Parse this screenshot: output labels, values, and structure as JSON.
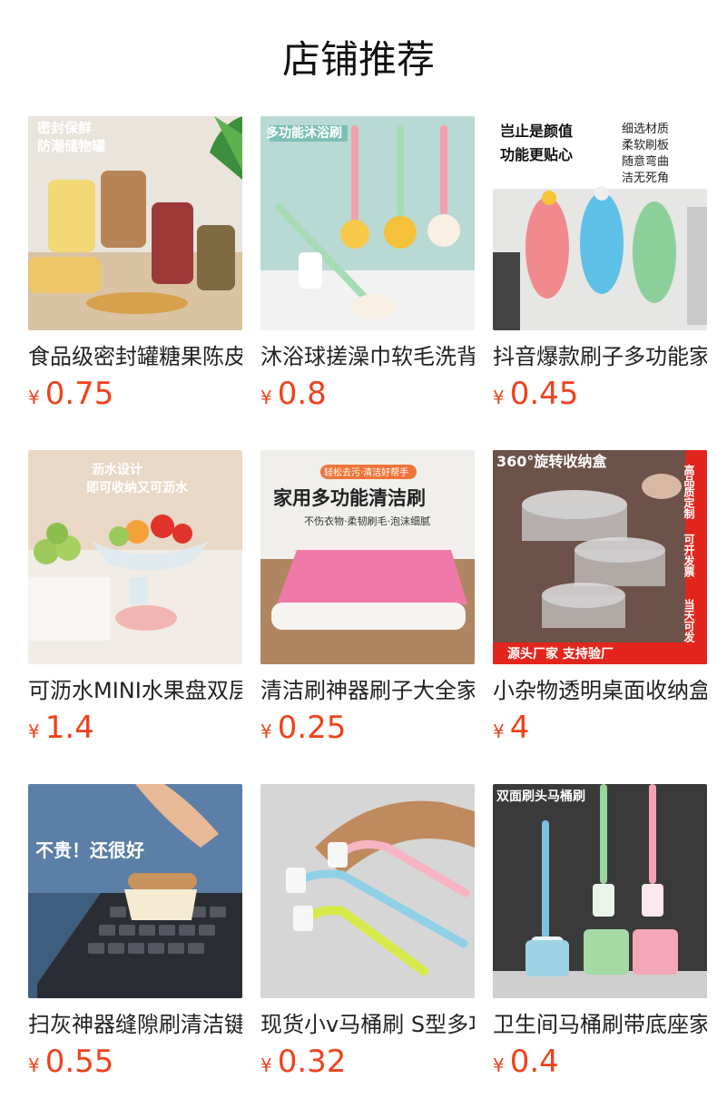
{
  "header": {
    "title": "店铺推荐"
  },
  "currency_symbol": "¥",
  "products": [
    {
      "name": "食品级密封罐糖果陈皮",
      "price": "0.75",
      "image_text": [
        "密封保鲜",
        "防潮储物罐"
      ]
    },
    {
      "name": "沐浴球搓澡巾软毛洗背",
      "price": "0.8",
      "image_text": [
        "多功能沐浴刷"
      ]
    },
    {
      "name": "抖音爆款刷子多功能家用",
      "price": "0.45",
      "image_text": [
        "岂止是颜值",
        "功能更贴心",
        "细选材质",
        "柔软刷板",
        "随意弯曲",
        "洁无死角"
      ]
    },
    {
      "name": "可沥水MINI水果盘双层",
      "price": "1.4",
      "image_text": [
        "沥水设计",
        "即可收纳又可沥水"
      ]
    },
    {
      "name": "清洁刷神器刷子大全家用",
      "price": "0.25",
      "image_text": [
        "轻松去污·清洁好帮手",
        "家用多功能清洁刷",
        "不伤衣物·柔韧刷毛·泡沫细腻"
      ]
    },
    {
      "name": "小杂物透明桌面收纳盒",
      "price": "4",
      "image_text": [
        "360°旋转收纳盒",
        "高品质定制",
        "可开发票",
        "当天可发",
        "源头厂家  支持验厂"
      ]
    },
    {
      "name": "扫灰神器缝隙刷清洁键盘",
      "price": "0.55",
      "image_text": [
        "不贵！还很好"
      ]
    },
    {
      "name": "现货小v马桶刷 S型多功能",
      "price": "0.32",
      "image_text": []
    },
    {
      "name": "卫生间马桶刷带底座家用",
      "price": "0.4",
      "image_text": [
        "双面刷头马桶刷"
      ]
    }
  ]
}
